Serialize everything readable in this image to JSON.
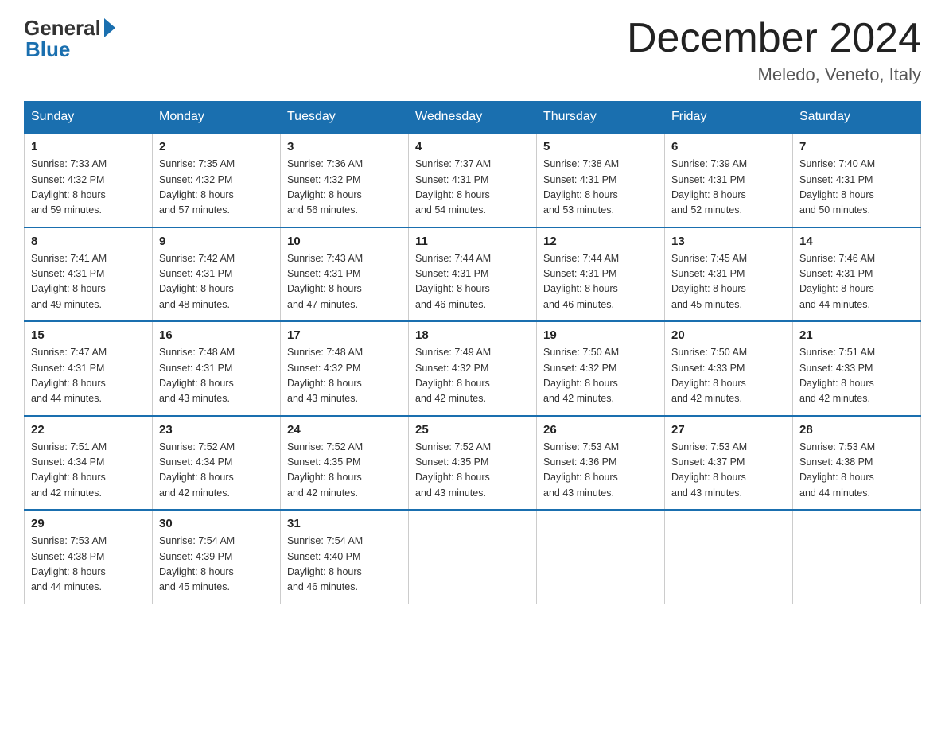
{
  "header": {
    "logo_general": "General",
    "logo_blue": "Blue",
    "month_title": "December 2024",
    "location": "Meledo, Veneto, Italy"
  },
  "days_of_week": [
    "Sunday",
    "Monday",
    "Tuesday",
    "Wednesday",
    "Thursday",
    "Friday",
    "Saturday"
  ],
  "weeks": [
    [
      {
        "day": "1",
        "sunrise": "7:33 AM",
        "sunset": "4:32 PM",
        "daylight": "8 hours and 59 minutes."
      },
      {
        "day": "2",
        "sunrise": "7:35 AM",
        "sunset": "4:32 PM",
        "daylight": "8 hours and 57 minutes."
      },
      {
        "day": "3",
        "sunrise": "7:36 AM",
        "sunset": "4:32 PM",
        "daylight": "8 hours and 56 minutes."
      },
      {
        "day": "4",
        "sunrise": "7:37 AM",
        "sunset": "4:31 PM",
        "daylight": "8 hours and 54 minutes."
      },
      {
        "day": "5",
        "sunrise": "7:38 AM",
        "sunset": "4:31 PM",
        "daylight": "8 hours and 53 minutes."
      },
      {
        "day": "6",
        "sunrise": "7:39 AM",
        "sunset": "4:31 PM",
        "daylight": "8 hours and 52 minutes."
      },
      {
        "day": "7",
        "sunrise": "7:40 AM",
        "sunset": "4:31 PM",
        "daylight": "8 hours and 50 minutes."
      }
    ],
    [
      {
        "day": "8",
        "sunrise": "7:41 AM",
        "sunset": "4:31 PM",
        "daylight": "8 hours and 49 minutes."
      },
      {
        "day": "9",
        "sunrise": "7:42 AM",
        "sunset": "4:31 PM",
        "daylight": "8 hours and 48 minutes."
      },
      {
        "day": "10",
        "sunrise": "7:43 AM",
        "sunset": "4:31 PM",
        "daylight": "8 hours and 47 minutes."
      },
      {
        "day": "11",
        "sunrise": "7:44 AM",
        "sunset": "4:31 PM",
        "daylight": "8 hours and 46 minutes."
      },
      {
        "day": "12",
        "sunrise": "7:44 AM",
        "sunset": "4:31 PM",
        "daylight": "8 hours and 46 minutes."
      },
      {
        "day": "13",
        "sunrise": "7:45 AM",
        "sunset": "4:31 PM",
        "daylight": "8 hours and 45 minutes."
      },
      {
        "day": "14",
        "sunrise": "7:46 AM",
        "sunset": "4:31 PM",
        "daylight": "8 hours and 44 minutes."
      }
    ],
    [
      {
        "day": "15",
        "sunrise": "7:47 AM",
        "sunset": "4:31 PM",
        "daylight": "8 hours and 44 minutes."
      },
      {
        "day": "16",
        "sunrise": "7:48 AM",
        "sunset": "4:31 PM",
        "daylight": "8 hours and 43 minutes."
      },
      {
        "day": "17",
        "sunrise": "7:48 AM",
        "sunset": "4:32 PM",
        "daylight": "8 hours and 43 minutes."
      },
      {
        "day": "18",
        "sunrise": "7:49 AM",
        "sunset": "4:32 PM",
        "daylight": "8 hours and 42 minutes."
      },
      {
        "day": "19",
        "sunrise": "7:50 AM",
        "sunset": "4:32 PM",
        "daylight": "8 hours and 42 minutes."
      },
      {
        "day": "20",
        "sunrise": "7:50 AM",
        "sunset": "4:33 PM",
        "daylight": "8 hours and 42 minutes."
      },
      {
        "day": "21",
        "sunrise": "7:51 AM",
        "sunset": "4:33 PM",
        "daylight": "8 hours and 42 minutes."
      }
    ],
    [
      {
        "day": "22",
        "sunrise": "7:51 AM",
        "sunset": "4:34 PM",
        "daylight": "8 hours and 42 minutes."
      },
      {
        "day": "23",
        "sunrise": "7:52 AM",
        "sunset": "4:34 PM",
        "daylight": "8 hours and 42 minutes."
      },
      {
        "day": "24",
        "sunrise": "7:52 AM",
        "sunset": "4:35 PM",
        "daylight": "8 hours and 42 minutes."
      },
      {
        "day": "25",
        "sunrise": "7:52 AM",
        "sunset": "4:35 PM",
        "daylight": "8 hours and 43 minutes."
      },
      {
        "day": "26",
        "sunrise": "7:53 AM",
        "sunset": "4:36 PM",
        "daylight": "8 hours and 43 minutes."
      },
      {
        "day": "27",
        "sunrise": "7:53 AM",
        "sunset": "4:37 PM",
        "daylight": "8 hours and 43 minutes."
      },
      {
        "day": "28",
        "sunrise": "7:53 AM",
        "sunset": "4:38 PM",
        "daylight": "8 hours and 44 minutes."
      }
    ],
    [
      {
        "day": "29",
        "sunrise": "7:53 AM",
        "sunset": "4:38 PM",
        "daylight": "8 hours and 44 minutes."
      },
      {
        "day": "30",
        "sunrise": "7:54 AM",
        "sunset": "4:39 PM",
        "daylight": "8 hours and 45 minutes."
      },
      {
        "day": "31",
        "sunrise": "7:54 AM",
        "sunset": "4:40 PM",
        "daylight": "8 hours and 46 minutes."
      },
      null,
      null,
      null,
      null
    ]
  ],
  "labels": {
    "sunrise": "Sunrise:",
    "sunset": "Sunset:",
    "daylight": "Daylight:"
  }
}
